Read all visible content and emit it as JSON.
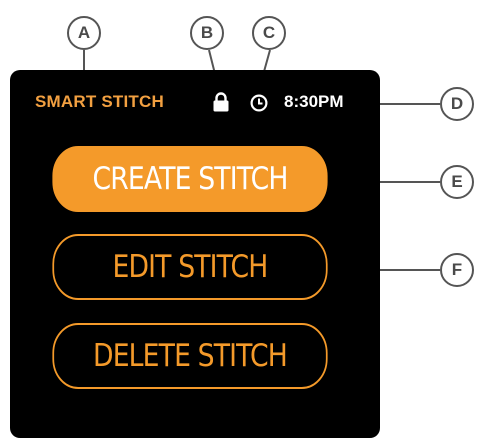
{
  "device": {
    "app_title": "SMART STITCH",
    "time": "8:30PM",
    "status_icons": [
      "lock-icon",
      "clock-icon"
    ]
  },
  "buttons": {
    "create": "CREATE STITCH",
    "edit": "EDIT STITCH",
    "delete": "DELETE STITCH"
  },
  "callouts": {
    "a": "A",
    "b": "B",
    "c": "C",
    "d": "D",
    "e": "E",
    "f": "F"
  },
  "colors": {
    "accent": "#f49a2a",
    "title": "#f2a041",
    "screen": "#000000",
    "callout_border": "#555555"
  }
}
